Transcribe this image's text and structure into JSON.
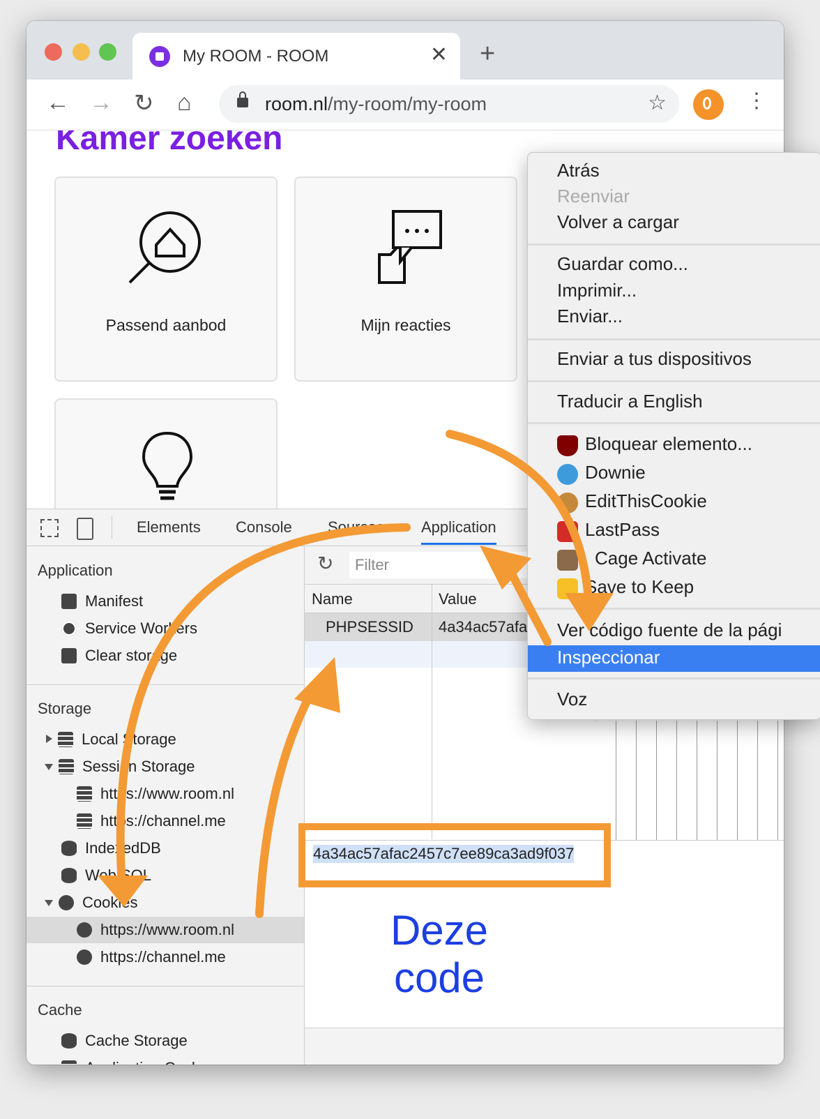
{
  "browser": {
    "tab_title": "My ROOM - ROOM",
    "tab_close": "✕",
    "new_tab": "+",
    "url_domain": "room.nl",
    "url_path": "/my-room/my-room",
    "nav": {
      "back": "←",
      "forward": "→",
      "reload": "↻",
      "home": "⌂"
    },
    "star": "☆",
    "menu": "⋮"
  },
  "page": {
    "heading": "Kamer zoeken",
    "cards": [
      {
        "label": "Passend aanbod",
        "icon": "house-search-icon"
      },
      {
        "label": "Mijn reacties",
        "icon": "chat-house-icon"
      },
      {
        "label": "",
        "icon": "lightbulb-icon"
      }
    ]
  },
  "devtools": {
    "tabs": [
      "Elements",
      "Console",
      "Sources",
      "Application"
    ],
    "active_tab": "Application",
    "sidebar": {
      "application_section": "Application",
      "application_items": [
        "Manifest",
        "Service Workers",
        "Clear storage"
      ],
      "storage_section": "Storage",
      "local_storage": "Local Storage",
      "session_storage": "Session Storage",
      "session_children": [
        "https://www.room.nl",
        "https://channel.me"
      ],
      "indexeddb": "IndexedDB",
      "websql": "Web SQL",
      "cookies": "Cookies",
      "cookie_children": [
        "https://www.room.nl",
        "https://channel.me"
      ],
      "cache_section": "Cache",
      "cache_items": [
        "Cache Storage",
        "Application Cache"
      ]
    },
    "filter_placeholder": "Filter",
    "table": {
      "columns": [
        "Name",
        "Value"
      ],
      "rows": [
        {
          "name": "PHPSESSID",
          "value": "4a34ac57afa"
        }
      ]
    },
    "selected_value": "4a34ac57afac2457c7ee89ca3ad9f037"
  },
  "context_menu": {
    "items_group1": [
      "Atrás",
      "Reenviar",
      "Volver a cargar"
    ],
    "disabled": [
      "Reenviar"
    ],
    "items_group2": [
      "Guardar como...",
      "Imprimir...",
      "Enviar..."
    ],
    "items_group3": [
      "Enviar a tus dispositivos"
    ],
    "items_group4": [
      "Traducir a English"
    ],
    "extensions": [
      {
        "label": "Bloquear elemento...",
        "icon": "ublock-icon",
        "color": "#800000"
      },
      {
        "label": "Downie",
        "icon": "downie-icon",
        "color": "#3d9bdc"
      },
      {
        "label": "EditThisCookie",
        "icon": "cookie-icon",
        "color": "#c48a3a"
      },
      {
        "label": "LastPass",
        "icon": "lastpass-icon",
        "color": "#d32d27"
      },
      {
        "label": "Cage Activate",
        "icon": "cage-icon",
        "color": "#8a6a4a"
      },
      {
        "label": "Save to Keep",
        "icon": "keep-icon",
        "color": "#f6c026"
      }
    ],
    "view_source": "Ver código fuente de la pági",
    "inspect": "Inspeccionar",
    "voice": "Voz"
  },
  "annotation": {
    "line1": "Deze",
    "line2": "code",
    "color": "#1c3fe0",
    "arrow_color": "#f39a35"
  }
}
